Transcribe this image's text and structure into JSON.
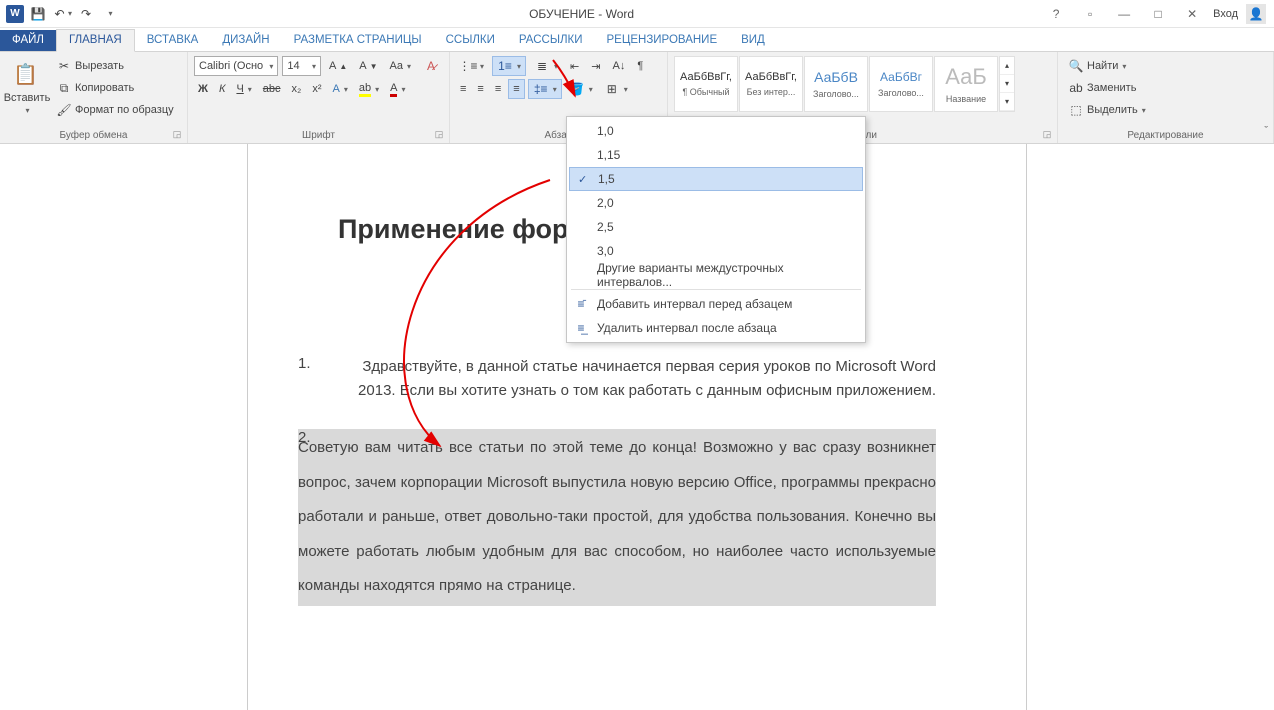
{
  "title": "ОБУЧЕНИЕ - Word",
  "login_label": "Вход",
  "tabs": {
    "file": "ФАЙЛ",
    "home": "ГЛАВНАЯ",
    "insert": "ВСТАВКА",
    "design": "ДИЗАЙН",
    "layout": "РАЗМЕТКА СТРАНИЦЫ",
    "references": "ССЫЛКИ",
    "mailings": "РАССЫЛКИ",
    "review": "РЕЦЕНЗИРОВАНИЕ",
    "view": "ВИД"
  },
  "clipboard": {
    "paste": "Вставить",
    "cut": "Вырезать",
    "copy": "Копировать",
    "format_painter": "Формат по образцу",
    "label": "Буфер обмена"
  },
  "font": {
    "name": "Calibri (Осно",
    "size": "14",
    "label": "Шрифт"
  },
  "paragraph": {
    "label": "Абзац"
  },
  "styles": {
    "label": "Стили",
    "items": [
      {
        "sample": "АаБбВвГг,",
        "name": "¶ Обычный"
      },
      {
        "sample": "АаБбВвГг,",
        "name": "Без интер..."
      },
      {
        "sample": "АаБбВ",
        "name": "Заголово..."
      },
      {
        "sample": "АаБбВг",
        "name": "Заголово..."
      },
      {
        "sample": "АаБ",
        "name": "Название"
      }
    ]
  },
  "editing": {
    "find": "Найти",
    "replace": "Заменить",
    "select": "Выделить",
    "label": "Редактирование"
  },
  "spacing_menu": {
    "o10": "1,0",
    "o115": "1,15",
    "o15": "1,5",
    "o20": "2,0",
    "o25": "2,5",
    "o30": "3,0",
    "more": "Другие варианты междустрочных интервалов...",
    "add_before": "Добавить интервал перед абзацем",
    "remove_after": "Удалить интервал после абзаца"
  },
  "doc": {
    "heading": "Применение форматирования",
    "p1": "Здравствуйте, в данной статье начинается первая серия уроков по Microsoft Word 2013. Если вы хотите узнать о том как работать с данным офисным приложением.",
    "p2": "Советую вам читать все статьи по этой теме до конца! Возможно у вас сразу возникнет вопрос, зачем корпорации Microsoft выпустила новую версию Office, программы прекрасно работали и раньше, ответ довольно-таки простой, для удобства пользования. Конечно вы можете работать любым удобным для вас способом, но наиболее часто используемые команды находятся прямо на странице."
  }
}
